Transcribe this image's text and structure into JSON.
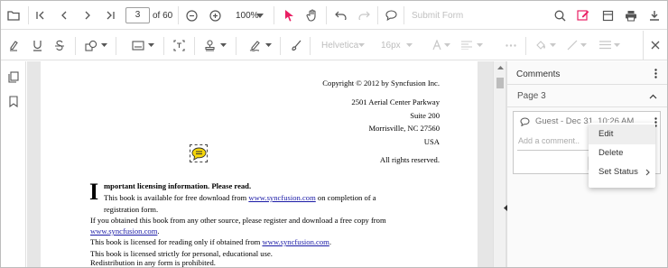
{
  "toolbar": {
    "page_current": "3",
    "page_total_label": "of 60",
    "zoom_label": "100%",
    "submit_label": "Submit Form",
    "font_family": "Helvetica",
    "font_size": "16px"
  },
  "document": {
    "copyright": "Copyright © 2012 by Syncfusion Inc.",
    "address_1": "2501 Aerial Center Parkway",
    "address_2": "Suite 200",
    "address_3": "Morrisville, NC 27560",
    "address_4": "USA",
    "rights": "All rights reserved.",
    "dropcap": "I",
    "heading": "mportant licensing information. Please read.",
    "line1_pre": "This book is available for free download from ",
    "link": "www.syncfusion.com",
    "line1_post": " on completion of a",
    "line2": "registration form.",
    "line3": "If you obtained this book from any other source, please register and download a free copy from",
    "line4_link": "www.syncfusion.com",
    "line4_post": ".",
    "line5_pre": "This book is licensed for reading only if obtained from ",
    "line5_link": "www.syncfusion.com",
    "line5_post": ".",
    "line6": "This book is licensed strictly for personal, educational use.",
    "line7": "Redistribution in any form is prohibited."
  },
  "comments": {
    "title": "Comments",
    "page_label": "Page 3",
    "author": "Guest - Dec 31, 10:26 AM",
    "input_placeholder": "Add a comment..",
    "menu": [
      "Edit",
      "Delete",
      "Set Status"
    ]
  },
  "colors": {
    "accent_pink": "#e91e63",
    "sticky_yellow": "#f5d60a"
  }
}
